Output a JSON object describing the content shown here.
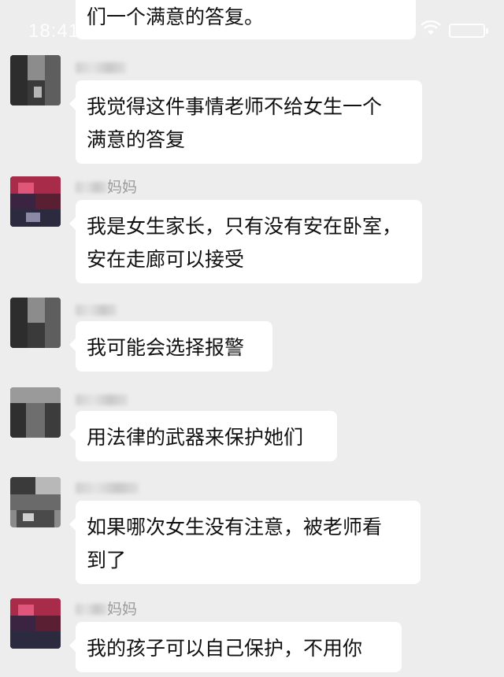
{
  "status": {
    "time": "18:41"
  },
  "messages": [
    {
      "sender": "",
      "lines": [
        "们一个满意的答复。"
      ]
    },
    {
      "sender": "",
      "lines": [
        "我觉得这件事情老师不给女生一个",
        "满意的答复"
      ]
    },
    {
      "sender": "妈妈",
      "lines": [
        "我是女生家长，只有没有安在卧室，",
        "安在走廊可以接受"
      ]
    },
    {
      "sender": "",
      "lines": [
        "我可能会选择报警"
      ]
    },
    {
      "sender": "",
      "lines": [
        "用法律的武器来保护她们"
      ]
    },
    {
      "sender": "",
      "lines": [
        "如果哪次女生没有注意，被老师看",
        "到了"
      ]
    },
    {
      "sender": "妈妈",
      "lines": [
        "我的孩子可以自己保护，不用你"
      ]
    }
  ],
  "icons": {
    "wifi": "wifi-icon",
    "battery": "battery-icon"
  },
  "colors": {
    "background": "#ededed",
    "bubble": "#ffffff",
    "sender": "#9a9a9a"
  }
}
